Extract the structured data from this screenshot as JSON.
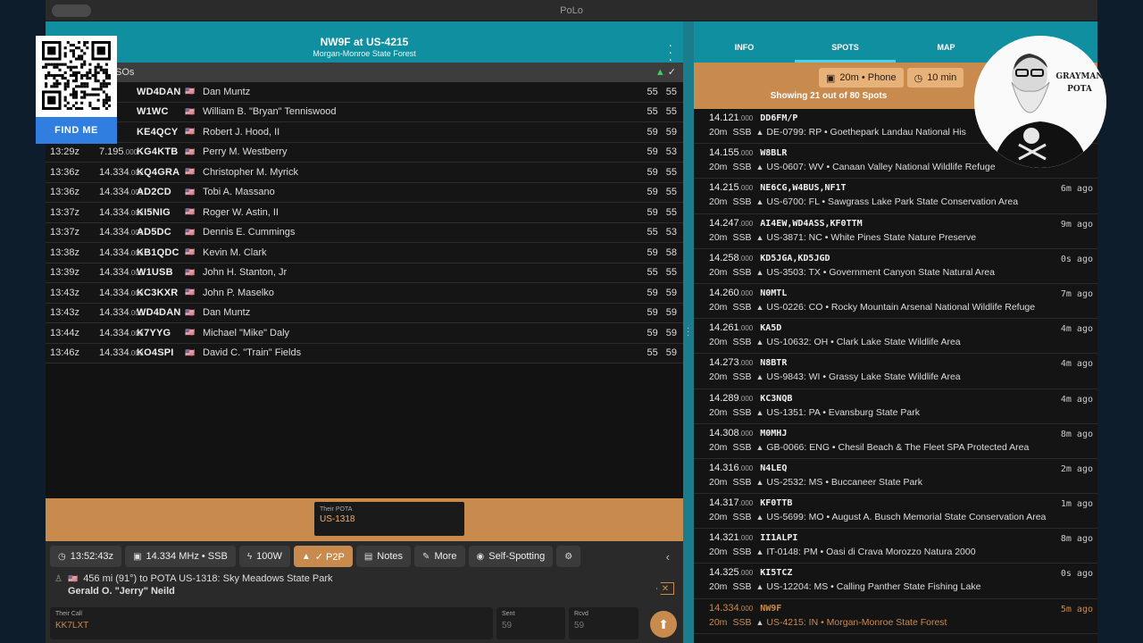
{
  "app": {
    "title": "PoLo"
  },
  "header": {
    "title": "NW9F at US-4215",
    "subtitle": "Morgan-Monroe State Forest"
  },
  "qso_list": {
    "label": "SOs",
    "rows": [
      {
        "time": "",
        "freq": "",
        "unit": ".000",
        "call": "WD4DAN",
        "flag": "🇺🇸",
        "name": "Dan Muntz",
        "rst": "55 55"
      },
      {
        "time": "",
        "freq": "",
        "unit": ".000",
        "call": "W1WC",
        "flag": "🇺🇸",
        "name": "William B. \"Bryan\" Tenniswood",
        "rst": "55 55"
      },
      {
        "time": "",
        "freq": "",
        "unit": ".000",
        "call": "KE4QCY",
        "flag": "🇺🇸",
        "name": "Robert J. Hood, II",
        "rst": "59 59"
      },
      {
        "time": "13:29z",
        "freq": "7.195",
        "unit": ".000",
        "call": "KG4KTB",
        "flag": "🇺🇸",
        "name": "Perry M. Westberry",
        "rst": "59 53"
      },
      {
        "time": "13:36z",
        "freq": "14.334",
        "unit": ".000",
        "call": "KQ4GRA",
        "flag": "🇺🇸",
        "name": "Christopher M. Myrick",
        "rst": "59 55"
      },
      {
        "time": "13:36z",
        "freq": "14.334",
        "unit": ".000",
        "call": "AD2CD",
        "flag": "🇺🇸",
        "name": "Tobi A. Massano",
        "rst": "59 55"
      },
      {
        "time": "13:37z",
        "freq": "14.334",
        "unit": ".000",
        "call": "KI5NIG",
        "flag": "🇺🇸",
        "name": "Roger W. Astin, II",
        "rst": "59 55"
      },
      {
        "time": "13:37z",
        "freq": "14.334",
        "unit": ".000",
        "call": "AD5DC",
        "flag": "🇺🇸",
        "name": "Dennis E. Cummings",
        "rst": "55 53"
      },
      {
        "time": "13:38z",
        "freq": "14.334",
        "unit": ".000",
        "call": "KB1QDC",
        "flag": "🇺🇸",
        "name": "Kevin M. Clark",
        "rst": "59 58"
      },
      {
        "time": "13:39z",
        "freq": "14.334",
        "unit": ".000",
        "call": "W1USB",
        "flag": "🇺🇸",
        "name": "John H. Stanton, Jr",
        "rst": "55 55"
      },
      {
        "time": "13:43z",
        "freq": "14.334",
        "unit": ".000",
        "call": "KC3KXR",
        "flag": "🇺🇸",
        "name": "John P. Maselko",
        "rst": "59 59"
      },
      {
        "time": "13:43z",
        "freq": "14.334",
        "unit": ".000",
        "call": "WD4DAN",
        "flag": "🇺🇸",
        "name": "Dan Muntz",
        "rst": "59 59"
      },
      {
        "time": "13:44z",
        "freq": "14.334",
        "unit": ".000",
        "call": "K7YYG",
        "flag": "🇺🇸",
        "name": "Michael \"Mike\" Daly",
        "rst": "59 59"
      },
      {
        "time": "13:46z",
        "freq": "14.334",
        "unit": ".000",
        "call": "KO4SPI",
        "flag": "🇺🇸",
        "name": "David C. \"Train\" Fields",
        "rst": "55 59"
      }
    ]
  },
  "their_pota": {
    "label": "Their POTA",
    "value": "US-1318"
  },
  "controls": {
    "time": "13:52:43z",
    "freq": "14.334 MHz • SSB",
    "power": "100W",
    "p2p": "✓ P2P",
    "notes": "Notes",
    "more": "More",
    "self_spotting": "Self-Spotting"
  },
  "info": {
    "line": "456 mi (91°) to POTA US-1318: Sky Meadows State Park",
    "name": "Gerald O. \"Jerry\" Neild"
  },
  "inputs": {
    "their_call_label": "Their Call",
    "their_call": "KK7LXT",
    "sent_label": "Sent",
    "sent": "59",
    "rcvd_label": "Rcvd",
    "rcvd": "59"
  },
  "tabs": [
    "INFO",
    "SPOTS",
    "MAP",
    "..."
  ],
  "spots_filter": {
    "band_mode": "20m • Phone",
    "window": "10 min",
    "showing": "Showing 21 out of 80 Spots"
  },
  "spots": [
    {
      "freq": "14.121",
      "unit": ".000",
      "call": "DD6FM/P",
      "band": "20m",
      "mode": "SSB",
      "park": "DE-0799: RP • Goethepark Landau National His",
      "ago": ""
    },
    {
      "freq": "14.155",
      "unit": ".000",
      "call": "W8BLR",
      "band": "20m",
      "mode": "SSB",
      "park": "US-0607: WV • Canaan Valley National Wildlife Refuge",
      "ago": ""
    },
    {
      "freq": "14.215",
      "unit": ".000",
      "call": "NE6CG,W4BUS,NF1T",
      "band": "20m",
      "mode": "SSB",
      "park": "US-6700: FL • Sawgrass Lake Park State Conservation Area",
      "ago": "6m ago"
    },
    {
      "freq": "14.247",
      "unit": ".000",
      "call": "AI4EW,WD4ASS,KF0TTM",
      "band": "20m",
      "mode": "SSB",
      "park": "US-3871: NC • White Pines State Nature Preserve",
      "ago": "9m ago"
    },
    {
      "freq": "14.258",
      "unit": ".000",
      "call": "KD5JGA,KD5JGD",
      "band": "20m",
      "mode": "SSB",
      "park": "US-3503: TX • Government Canyon State Natural Area",
      "ago": "0s ago"
    },
    {
      "freq": "14.260",
      "unit": ".000",
      "call": "N0MTL",
      "band": "20m",
      "mode": "SSB",
      "park": "US-0226: CO • Rocky Mountain Arsenal National Wildlife Refuge",
      "ago": "7m ago"
    },
    {
      "freq": "14.261",
      "unit": ".000",
      "call": "KA5D",
      "band": "20m",
      "mode": "SSB",
      "park": "US-10632: OH • Clark Lake State Wildlife Area",
      "ago": "4m ago"
    },
    {
      "freq": "14.273",
      "unit": ".000",
      "call": "N8BTR",
      "band": "20m",
      "mode": "SSB",
      "park": "US-9843: WI • Grassy Lake State Wildlife Area",
      "ago": "4m ago"
    },
    {
      "freq": "14.289",
      "unit": ".000",
      "call": "KC3NQB",
      "band": "20m",
      "mode": "SSB",
      "park": "US-1351: PA • Evansburg State Park",
      "ago": "4m ago"
    },
    {
      "freq": "14.308",
      "unit": ".000",
      "call": "M0MHJ",
      "band": "20m",
      "mode": "SSB",
      "park": "GB-0066: ENG • Chesil Beach & The Fleet SPA Protected Area",
      "ago": "8m ago"
    },
    {
      "freq": "14.316",
      "unit": ".000",
      "call": "N4LEQ",
      "band": "20m",
      "mode": "SSB",
      "park": "US-2532: MS • Buccaneer State Park",
      "ago": "2m ago"
    },
    {
      "freq": "14.317",
      "unit": ".000",
      "call": "KF0TTB",
      "band": "20m",
      "mode": "SSB",
      "park": "US-5699: MO • August A. Busch Memorial State Conservation Area",
      "ago": "1m ago"
    },
    {
      "freq": "14.321",
      "unit": ".000",
      "call": "II1ALPI",
      "band": "20m",
      "mode": "SSB",
      "park": "IT-0148: PM • Oasi di Crava Morozzo Natura 2000",
      "ago": "8m ago"
    },
    {
      "freq": "14.325",
      "unit": ".000",
      "call": "KI5TCZ",
      "band": "20m",
      "mode": "SSB",
      "park": "US-12204: MS • Calling Panther State Fishing Lake",
      "ago": "0s ago"
    },
    {
      "freq": "14.334",
      "unit": ".000",
      "call": "NW9F",
      "band": "20m",
      "mode": "SSB",
      "park": "US-4215: IN • Morgan-Monroe State Forest",
      "ago": "5m ago",
      "own": true
    }
  ],
  "overlay": {
    "find_me": "FIND ME",
    "avatar_text": "GRAYMAN POTA"
  },
  "colors": {
    "accent": "#c98a4d",
    "teal": "#0f8fa0",
    "find_me_blue": "#2f7ee0"
  }
}
